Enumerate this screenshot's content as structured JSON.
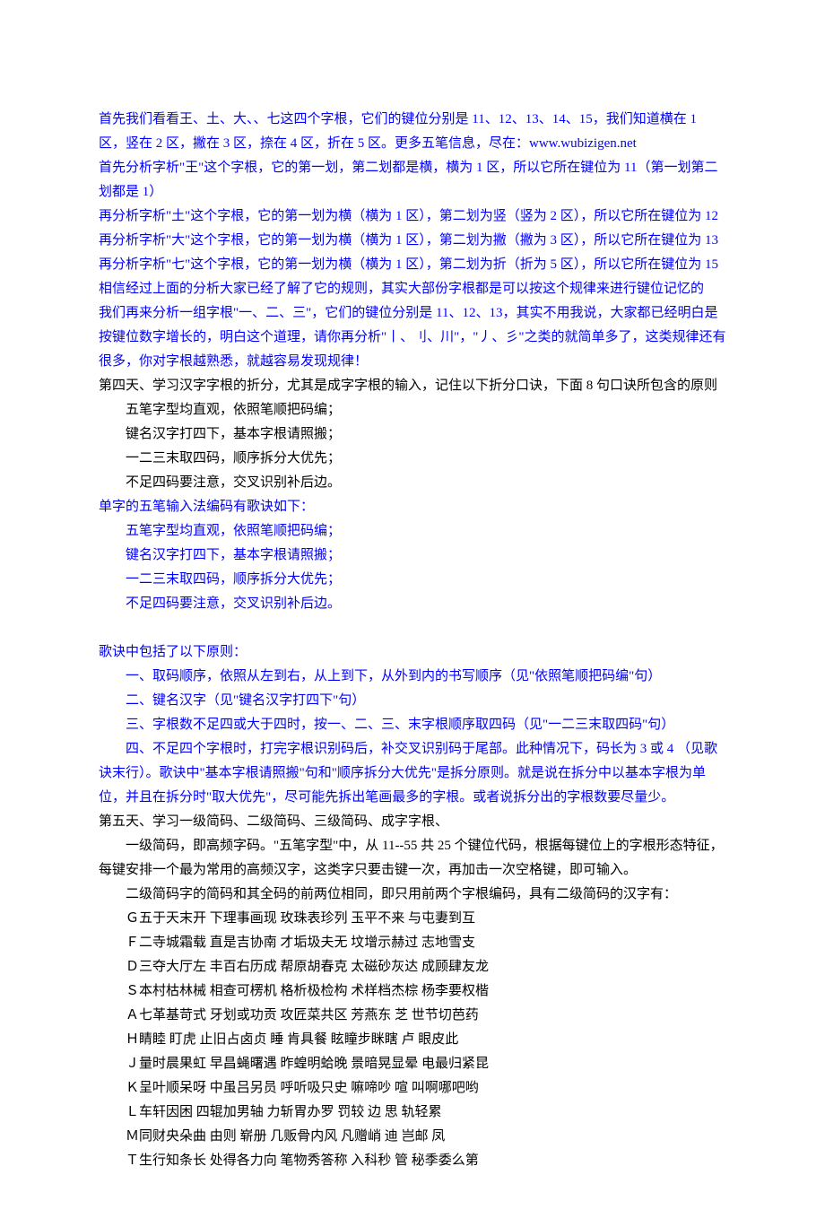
{
  "intro": {
    "p1": "首先我们看看王、土、大、、七这四个字根，它们的键位分别是 11、12、13、14、15，我们知道横在 1 区，竖在 2 区，撇在 3 区，捺在 4 区，折在 5 区。更多五笔信息，尽在：www.wubizigen.net",
    "p2": "首先分析字析\"王\"这个字根，它的第一划，第二划都是横，横为 1 区，所以它所在键位为 11（第一划第二划都是 1）",
    "p3": "再分析字析\"土\"这个字根，它的第一划为横（横为 1 区），第二划为竖（竖为 2 区），所以它所在键位为 12",
    "p4": "再分析字析\"大\"这个字根，它的第一划为横（横为 1 区），第二划为撇（撇为 3 区），所以它所在键位为 13",
    "p5": "再分析字析\"七\"这个字根，它的第一划为横（横为 1 区），第二划为折（折为 5 区），所以它所在键位为 15",
    "p6": "相信经过上面的分析大家已经了解了它的规则，其实大部份字根都是可以按这个规律来进行键位记忆的",
    "p7": "我们再来分析一组字根\"一、二、三\"，它们的键位分别是 11、12、13，其实不用我说，大家都已经明白是按键位数字增长的，明白这个道理，请你再分析\"丨、刂、川\"，\"丿、彡\"之类的就简单多了，这类规律还有很多，你对字根越熟悉，就越容易发现规律！"
  },
  "day4": {
    "title": "第四天、学习汉字字根的折分，尤其是成字字根的输入，记住以下折分口诀，下面 8 句口诀所包含的原则",
    "verseA": [
      "五笔字型均直观，依照笔顺把码编；",
      "键名汉字打四下，基本字根请照搬；",
      "一二三末取四码，顺序拆分大优先；",
      "不足四码要注意，交叉识别补后边。"
    ],
    "subtitleB": "单字的五笔输入法编码有歌诀如下：",
    "verseB": [
      "五笔字型均直观，依照笔顺把码编；",
      "键名汉字打四下，基本字根请照搬；",
      "一二三末取四码，顺序拆分大优先；",
      "不足四码要注意，交叉识别补后边。"
    ],
    "principlesTitle": "歌诀中包括了以下原则：",
    "principles": [
      "一、取码顺序，依照从左到右，从上到下，从外到内的书写顺序（见\"依照笔顺把码编\"句）",
      "二、键名汉字（见\"键名汉字打四下\"句）",
      "三、字根数不足四或大于四时，按一、二、三、末字根顺序取四码（见\"一二三末取四码\"句）",
      "四、不足四个字根时，打完字根识别码后，补交叉识别码于尾部。此种情况下，码长为 3 或 4 （见歌诀末行）。歌诀中\"基本字根请照搬\"句和\"顺序拆分大优先\"是拆分原则。就是说在拆分中以基本字根为单位，并且在拆分时\"取大优先\"，尽可能先拆出笔画最多的字根。或者说拆分出的字根数要尽量少。"
    ]
  },
  "day5": {
    "title": "第五天、学习一级简码、二级简码、三级简码、成字字根、",
    "p1": "一级简码，即高频字码。\"五笔字型\"中，从 11--55 共 25 个键位代码，根据每键位上的字根形态特征，每键安排一个最为常用的高频汉字，这类字只要击键一次，再加击一次空格键，即可输入。",
    "p2": "二级简码字的简码和其全码的前两位相同，即只用前两个字根编码，具有二级简码的汉字有：",
    "codes": [
      "Ｇ五于天末开 下理事画现 玫珠表珍列 玉平不来 与屯妻到互",
      "Ｆ二寺城霜载 直是吉协南 才垢圾夫无 坟增示赫过 志地雪支",
      "Ｄ三夺大厅左 丰百右历成 帮原胡春克 太磁砂灰达 成顾肆友龙",
      "Ｓ本村枯林械 相查可楞机 格析极检构 术样档杰棕 杨李要权楷",
      "Ａ七革基苛式 牙划或功贡 攻匠菜共区 芳燕东 芝 世节切芭药",
      "Ｈ睛睦 盯虎 止旧占卤贞 睡 肯具餐 眩瞳步眯瞎 卢 眼皮此",
      "Ｊ量时晨果虹 早昌蝇曙遇 昨蝗明蛤晚 景暗晃显晕 电最归紧昆",
      "Ｋ呈叶顺呆呀 中虽吕另员 呼听吸只史 嘛啼吵 喧 叫啊哪吧哟",
      "Ｌ车轩因困 四辊加男轴 力斩胃办罗 罚较 边 思 轨轻累",
      "Ｍ同财央朵曲 由则 崭册 几贩骨内风 凡赠峭 迪 岂邮 凤",
      "Ｔ生行知条长 处得各力向 笔物秀答称 入科秒 管 秘季委么第"
    ]
  }
}
